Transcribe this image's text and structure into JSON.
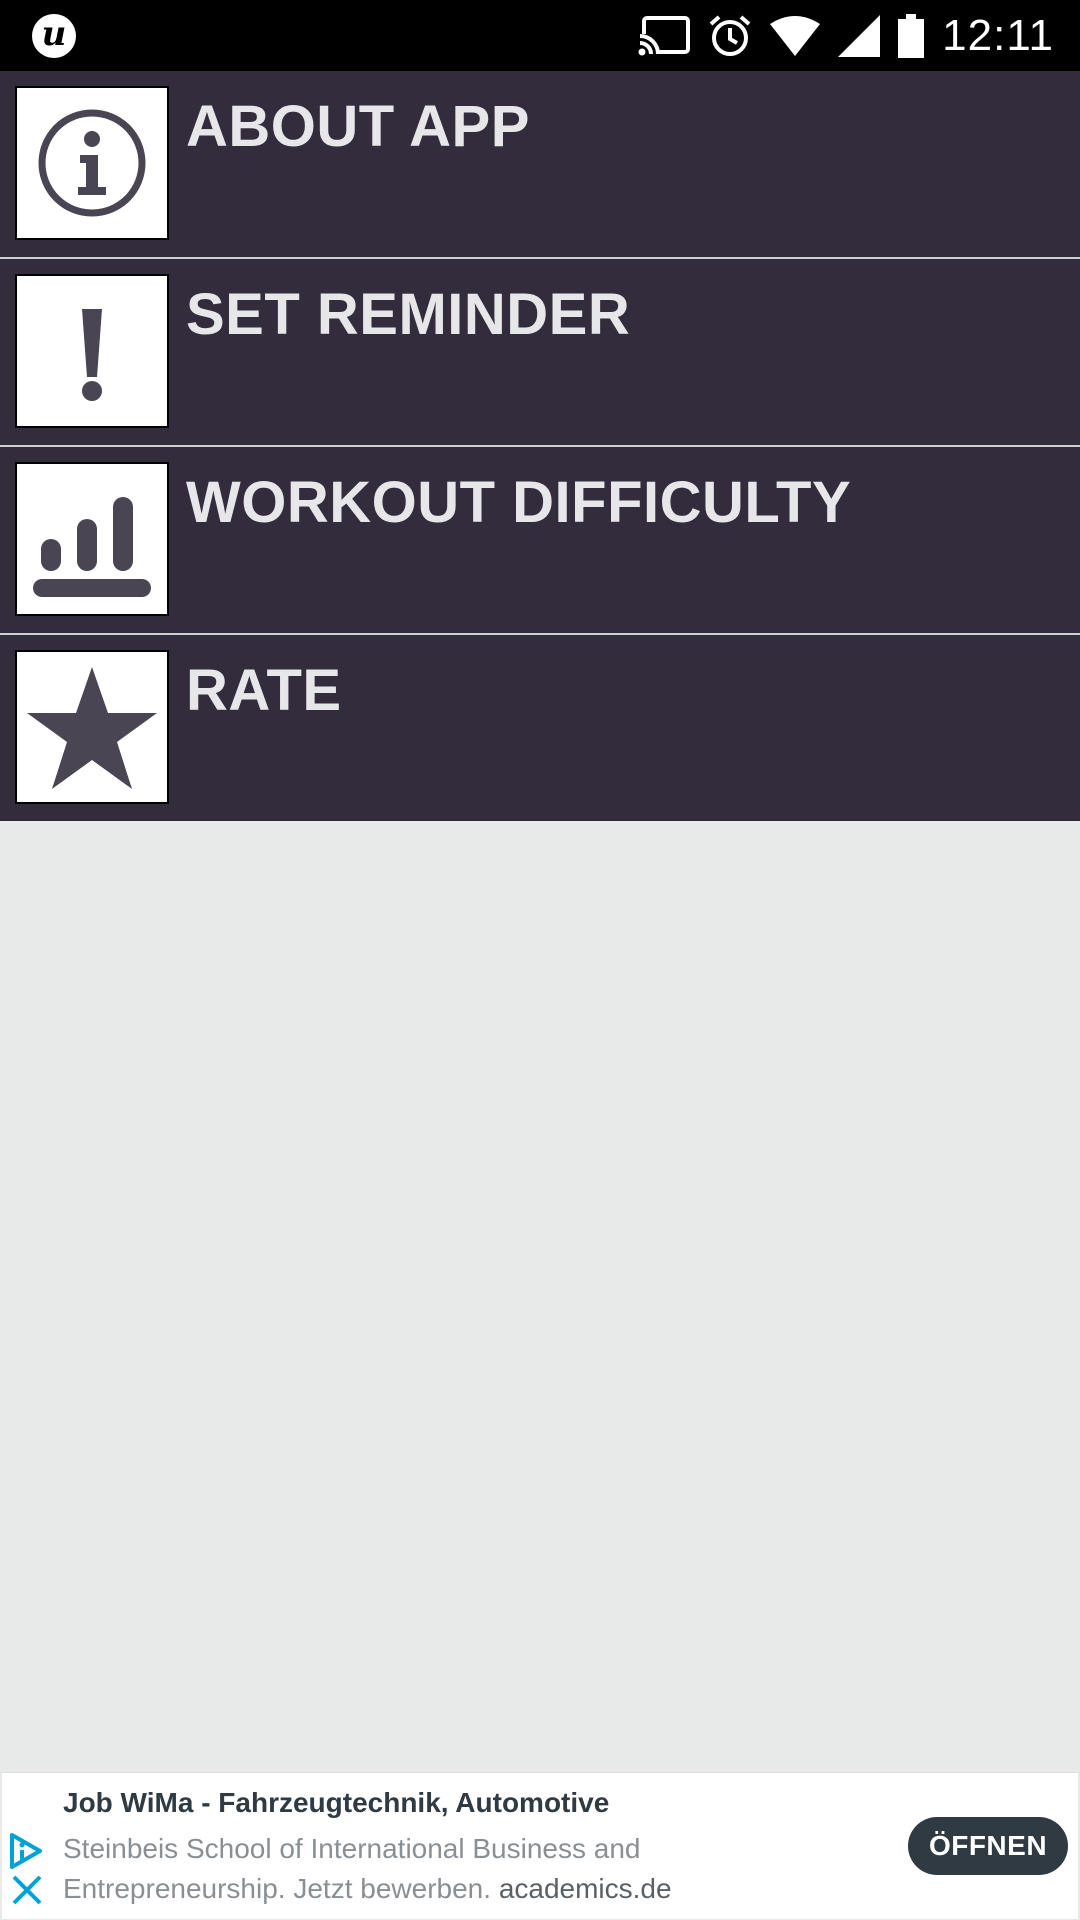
{
  "status_bar": {
    "app_icon_letter": "u",
    "time": "12:11",
    "icons": [
      "cast-icon",
      "alarm-icon",
      "wifi-icon",
      "signal-icon",
      "battery-icon"
    ]
  },
  "menu": {
    "items": [
      {
        "label": "ABOUT APP",
        "icon": "info-icon"
      },
      {
        "label": "SET REMINDER",
        "icon": "exclamation-icon"
      },
      {
        "label": "WORKOUT DIFFICULTY",
        "icon": "difficulty-bars-icon"
      },
      {
        "label": "RATE",
        "icon": "star-icon"
      }
    ]
  },
  "ad": {
    "title": "Job WiMa - Fahrzeugtechnik, Automotive",
    "description": "Steinbeis School of International Business and Entrepreneurship. Jetzt bewerben.",
    "domain": "academics.de",
    "button_label": "ÖFFNEN"
  },
  "colors": {
    "menu_bg": "#322c3c",
    "page_bg": "#e8e9e9",
    "icon_fg": "#4a4552",
    "ad_button_bg": "#2f3a42",
    "ad_accent": "#00a1d6"
  }
}
